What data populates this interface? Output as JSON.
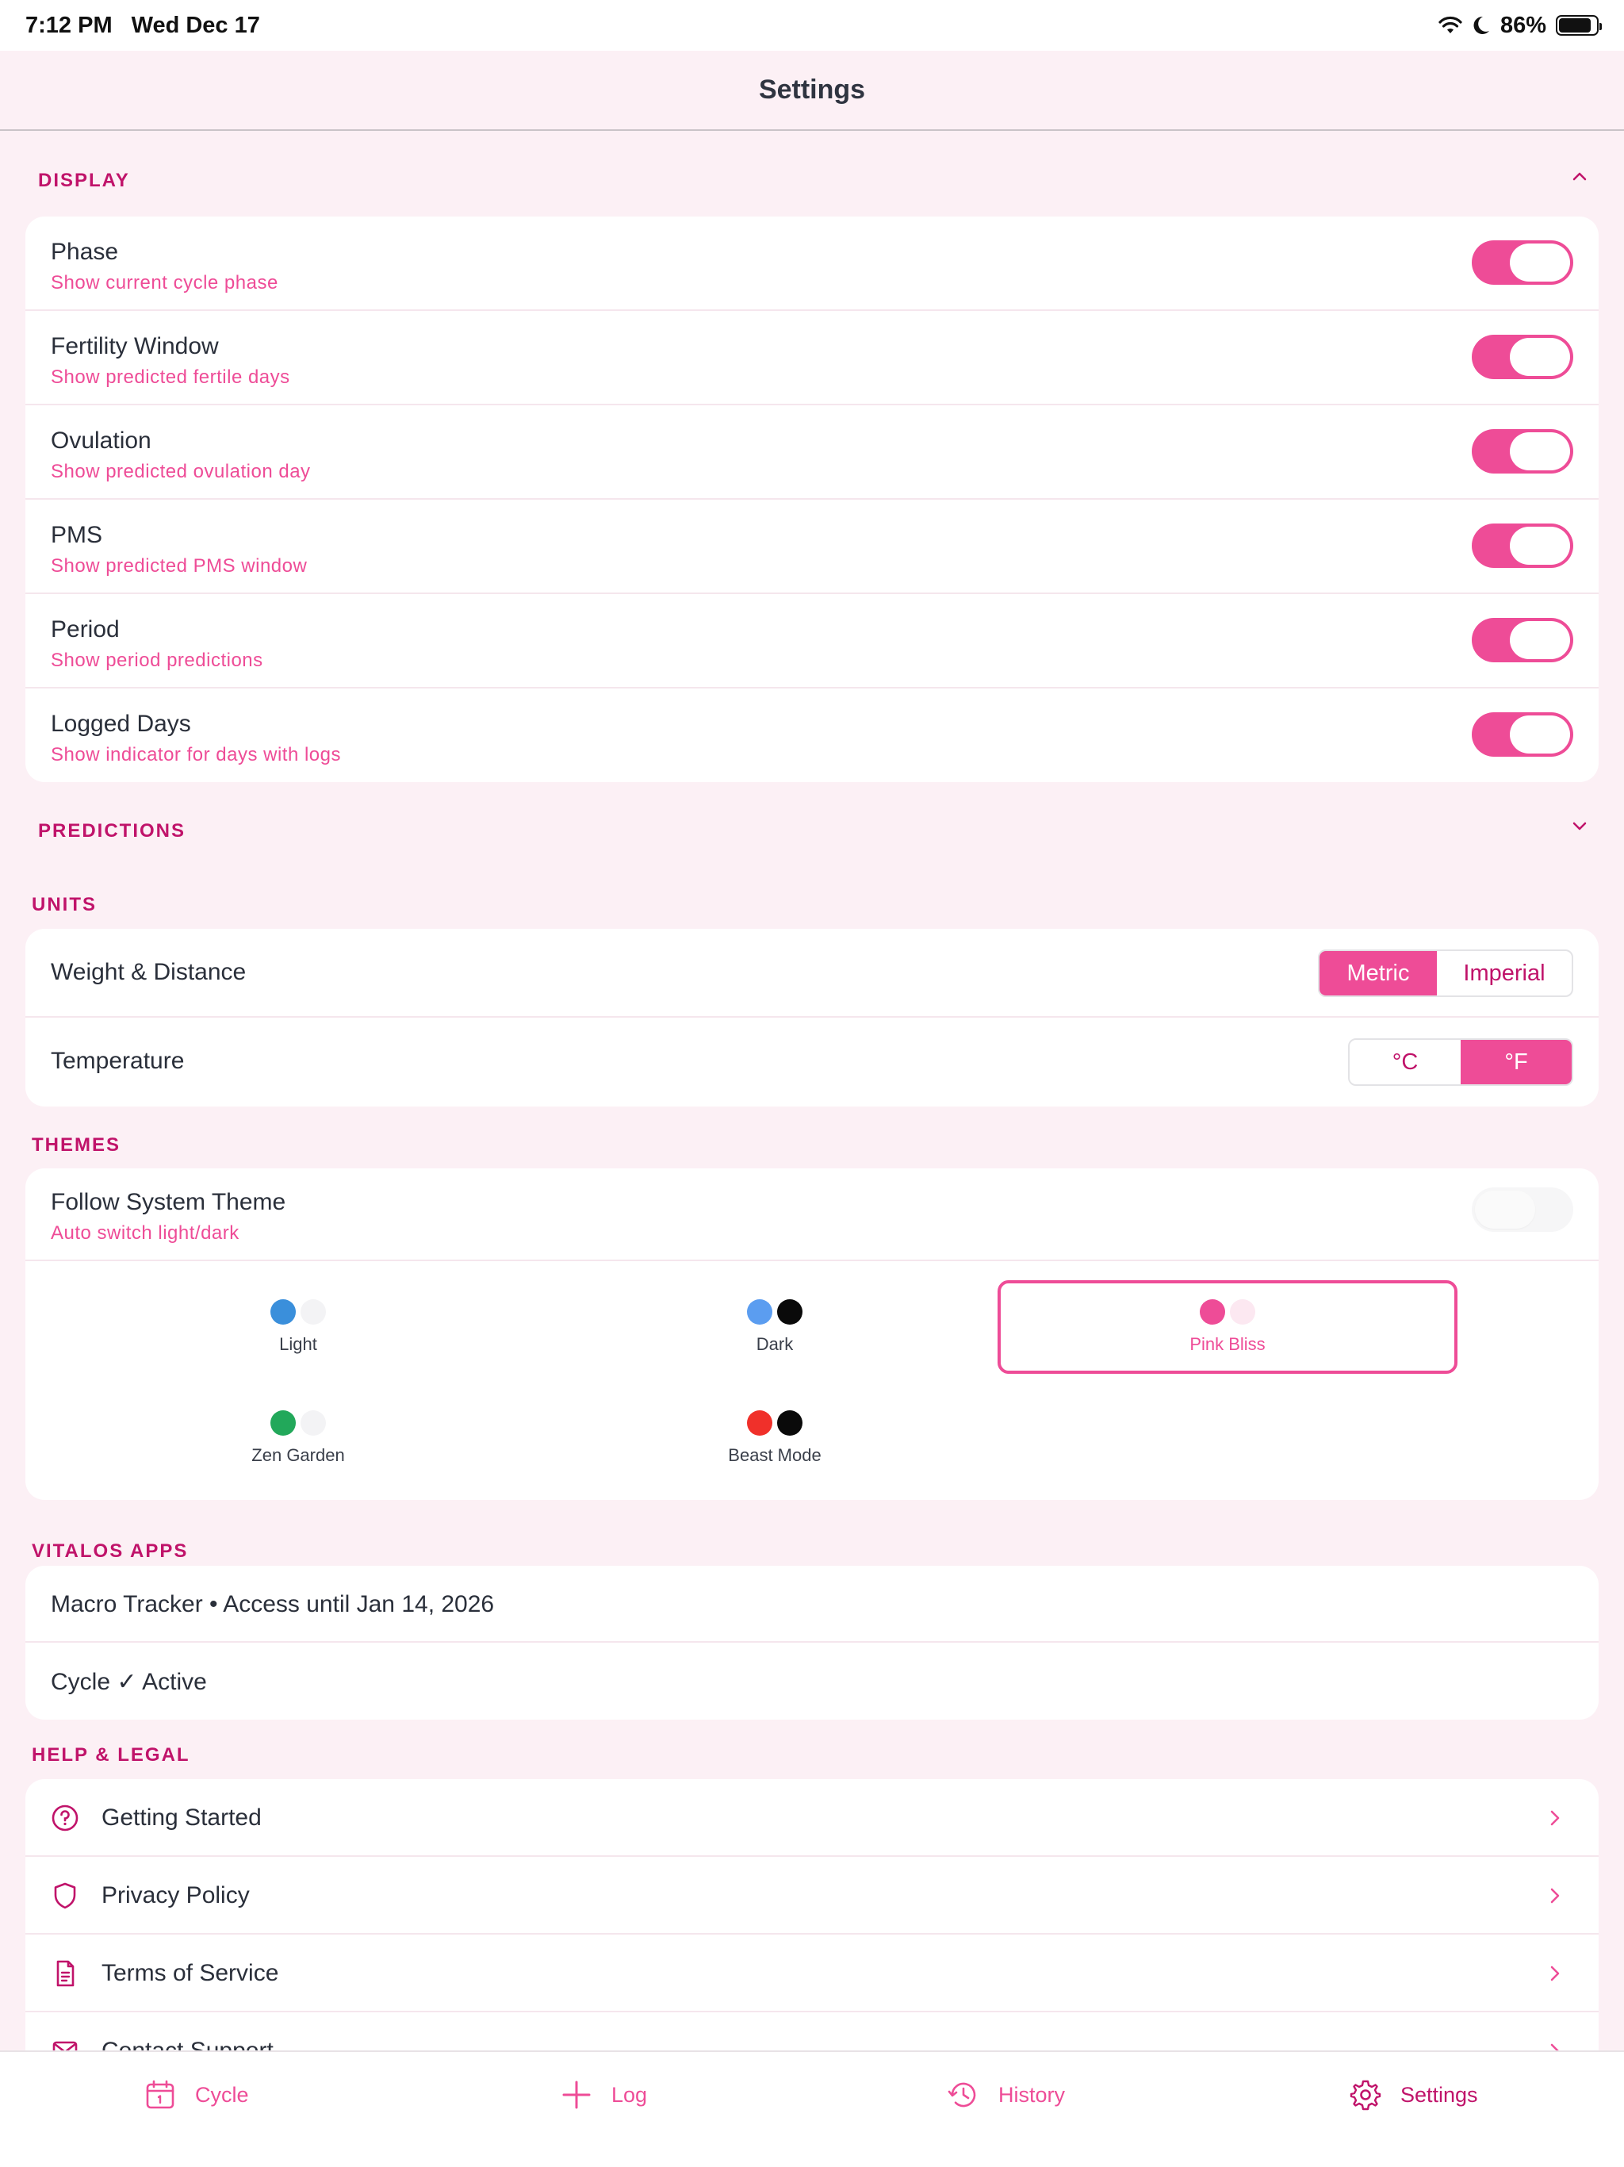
{
  "status_bar": {
    "time": "7:12 PM",
    "date": "Wed Dec 17",
    "battery_percent": "86%",
    "battery_level": 0.86
  },
  "nav": {
    "title": "Settings"
  },
  "display": {
    "header": "DISPLAY",
    "expanded": true,
    "rows": [
      {
        "title": "Phase",
        "subtitle": "Show current cycle phase",
        "on": true
      },
      {
        "title": "Fertility Window",
        "subtitle": "Show predicted fertile days",
        "on": true
      },
      {
        "title": "Ovulation",
        "subtitle": "Show predicted ovulation day",
        "on": true
      },
      {
        "title": "PMS",
        "subtitle": "Show predicted PMS window",
        "on": true
      },
      {
        "title": "Period",
        "subtitle": "Show period predictions",
        "on": true
      },
      {
        "title": "Logged Days",
        "subtitle": "Show indicator for days with logs",
        "on": true
      }
    ]
  },
  "predictions": {
    "header": "PREDICTIONS",
    "expanded": false
  },
  "units": {
    "header": "UNITS",
    "weight": {
      "title": "Weight & Distance",
      "options": [
        "Metric",
        "Imperial"
      ],
      "selected": "Metric"
    },
    "temperature": {
      "title": "Temperature",
      "options": [
        "°C",
        "°F"
      ],
      "selected": "°F"
    }
  },
  "themes": {
    "header": "THEMES",
    "follow_system": {
      "title": "Follow System Theme",
      "subtitle": "Auto switch light/dark",
      "on": false
    },
    "options": [
      {
        "label": "Light",
        "colors": [
          "#3a8fdb",
          "#f3f3f5"
        ]
      },
      {
        "label": "Dark",
        "colors": [
          "#5b9df0",
          "#0a0a0a"
        ]
      },
      {
        "label": "Pink Bliss",
        "colors": [
          "#ee4c97",
          "#fce8f1"
        ]
      },
      {
        "label": "Zen Garden",
        "colors": [
          "#22a85a",
          "#f3f3f5"
        ]
      },
      {
        "label": "Beast Mode",
        "colors": [
          "#f0302a",
          "#0a0a0a"
        ]
      }
    ],
    "selected": "Pink Bliss"
  },
  "apps": {
    "header": "VITALOS APPS",
    "rows": [
      "Macro Tracker • Access until Jan 14, 2026",
      "Cycle ✓ Active"
    ]
  },
  "help": {
    "header": "HELP & LEGAL",
    "rows": [
      {
        "label": "Getting Started",
        "icon": "question-circle-icon"
      },
      {
        "label": "Privacy Policy",
        "icon": "shield-icon"
      },
      {
        "label": "Terms of Service",
        "icon": "document-icon"
      },
      {
        "label": "Contact Support",
        "icon": "mail-icon"
      }
    ]
  },
  "tabs": [
    {
      "label": "Cycle",
      "icon": "calendar-icon"
    },
    {
      "label": "Log",
      "icon": "plus-icon"
    },
    {
      "label": "History",
      "icon": "history-icon"
    },
    {
      "label": "Settings",
      "icon": "gear-icon",
      "active": true
    }
  ],
  "colors": {
    "accent": "#ee4c97",
    "accent_dark": "#c0136a",
    "background": "#fcf0f5",
    "card": "#ffffff"
  }
}
